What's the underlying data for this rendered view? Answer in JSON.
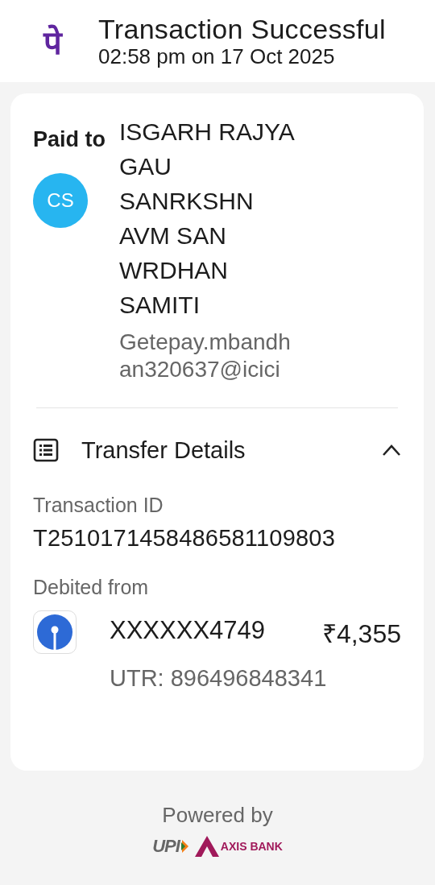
{
  "header": {
    "logo": "पे",
    "title": "Transaction Successful",
    "subtitle": "02:58 pm on 17 Oct 2025"
  },
  "paid_to": {
    "label": "Paid to",
    "avatar": "CS",
    "name": "ISGARH RAJYA GAU SANRKSHN AVM SAN WRDHAN SAMITI",
    "upi_id": "Getepay.mbandhan320637@icici"
  },
  "transfer_details": {
    "title": "Transfer Details",
    "expanded": true,
    "transaction_id_label": "Transaction ID",
    "transaction_id": "T2510171458486581109803",
    "debited_label": "Debited from",
    "account": "XXXXXX4749",
    "amount": "₹4,355",
    "utr": "UTR: 896496848341"
  },
  "footer": {
    "powered_by": "Powered by",
    "logos": [
      {
        "kind": "upi",
        "text": "UPI"
      },
      {
        "kind": "bank",
        "text": "AXIS BANK"
      }
    ]
  }
}
